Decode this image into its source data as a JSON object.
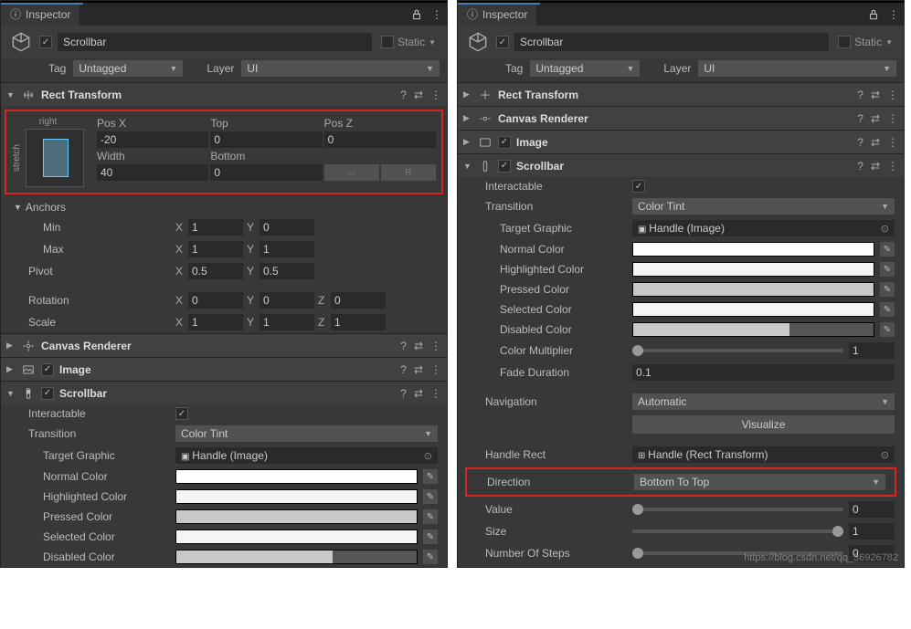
{
  "left": {
    "tab": "Inspector",
    "objName": "Scrollbar",
    "staticLabel": "Static",
    "tagLabel": "Tag",
    "tagValue": "Untagged",
    "layerLabel": "Layer",
    "layerValue": "UI",
    "rectTransform": {
      "title": "Rect Transform",
      "anchorPresetV": "stretch",
      "anchorPresetH": "right",
      "cols": [
        "Pos X",
        "Top",
        "Pos Z"
      ],
      "vals1": [
        "-20",
        "0",
        "0"
      ],
      "cols2": [
        "Width",
        "Bottom",
        ""
      ],
      "vals2": [
        "40",
        "0",
        ""
      ],
      "anchors": "Anchors",
      "minLbl": "Min",
      "min": {
        "x": "1",
        "y": "0"
      },
      "maxLbl": "Max",
      "max": {
        "x": "1",
        "y": "1"
      },
      "pivotLbl": "Pivot",
      "pivot": {
        "x": "0.5",
        "y": "0.5"
      },
      "rotLbl": "Rotation",
      "rot": {
        "x": "0",
        "y": "0",
        "z": "0"
      },
      "scaleLbl": "Scale",
      "scale": {
        "x": "1",
        "y": "1",
        "z": "1"
      }
    },
    "canvasRenderer": "Canvas Renderer",
    "image": "Image",
    "scrollbar": "Scrollbar",
    "sb": {
      "interactableLbl": "Interactable",
      "transitionLbl": "Transition",
      "transitionVal": "Color Tint",
      "targetGraphicLbl": "Target Graphic",
      "targetGraphicVal": "Handle (Image)",
      "normalColorLbl": "Normal Color",
      "normalColor": "#ffffff",
      "highlightedColorLbl": "Highlighted Color",
      "highlightedColor": "#f5f5f5",
      "pressedColorLbl": "Pressed Color",
      "pressedColor": "#c8c8c8",
      "selectedColorLbl": "Selected Color",
      "selectedColor": "#f5f5f5",
      "disabledColorLbl": "Disabled Color",
      "disabledColor": "#c8c8c8"
    }
  },
  "right": {
    "tab": "Inspector",
    "objName": "Scrollbar",
    "staticLabel": "Static",
    "tagLabel": "Tag",
    "tagValue": "Untagged",
    "layerLabel": "Layer",
    "layerValue": "UI",
    "rectTransform": "Rect Transform",
    "canvasRenderer": "Canvas Renderer",
    "image": "Image",
    "scrollbar": "Scrollbar",
    "sb": {
      "interactableLbl": "Interactable",
      "transitionLbl": "Transition",
      "transitionVal": "Color Tint",
      "targetGraphicLbl": "Target Graphic",
      "targetGraphicVal": "Handle (Image)",
      "normalColorLbl": "Normal Color",
      "normalColor": "#ffffff",
      "highlightedColorLbl": "Highlighted Color",
      "highlightedColor": "#f5f5f5",
      "pressedColorLbl": "Pressed Color",
      "pressedColor": "#c8c8c8",
      "selectedColorLbl": "Selected Color",
      "selectedColor": "#f5f5f5",
      "disabledColorLbl": "Disabled Color",
      "disabledColor": "#c8c8c8",
      "colorMultLbl": "Color Multiplier",
      "colorMultVal": "1",
      "fadeDurLbl": "Fade Duration",
      "fadeDurVal": "0.1",
      "navigationLbl": "Navigation",
      "navigationVal": "Automatic",
      "visualizeLbl": "Visualize",
      "handleRectLbl": "Handle Rect",
      "handleRectVal": "Handle (Rect Transform)",
      "directionLbl": "Direction",
      "directionVal": "Bottom To Top",
      "valueLbl": "Value",
      "valueVal": "0",
      "sizeLbl": "Size",
      "sizeVal": "1",
      "stepsLbl": "Number Of Steps",
      "stepsVal": "0"
    },
    "watermark": "https://blog.csdn.net/qq_36926782"
  }
}
